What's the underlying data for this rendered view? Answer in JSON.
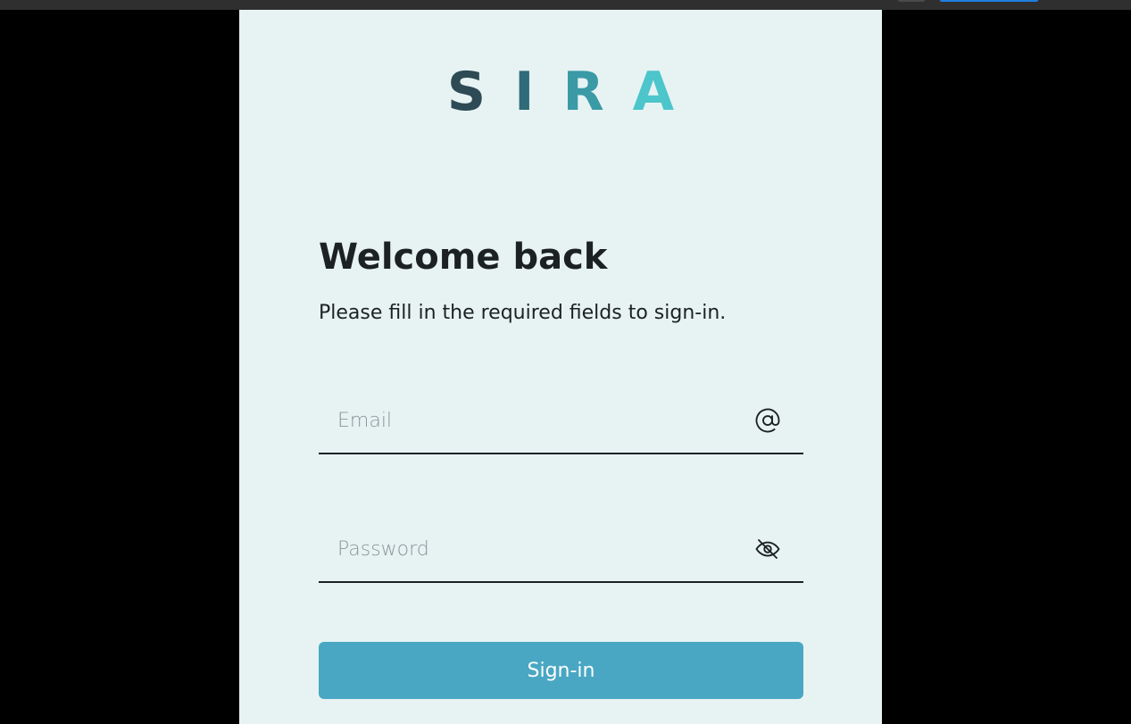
{
  "logo": {
    "letters": [
      "S",
      "I",
      "R",
      "A"
    ],
    "colors": [
      "#2d4a55",
      "#2f6b78",
      "#3a9aa6",
      "#4cc5cb"
    ]
  },
  "login": {
    "heading": "Welcome back",
    "subtitle": "Please fill in the required fields to sign-in.",
    "email": {
      "placeholder": "Email",
      "value": "",
      "icon": "at-sign-icon"
    },
    "password": {
      "placeholder": "Password",
      "value": "",
      "icon": "eye-slash-icon"
    },
    "submit_label": "Sign-in"
  },
  "colors": {
    "panel_background": "#e7f3f3",
    "text": "#1c2124",
    "button": "#49a7c3",
    "page_background": "#000000"
  }
}
